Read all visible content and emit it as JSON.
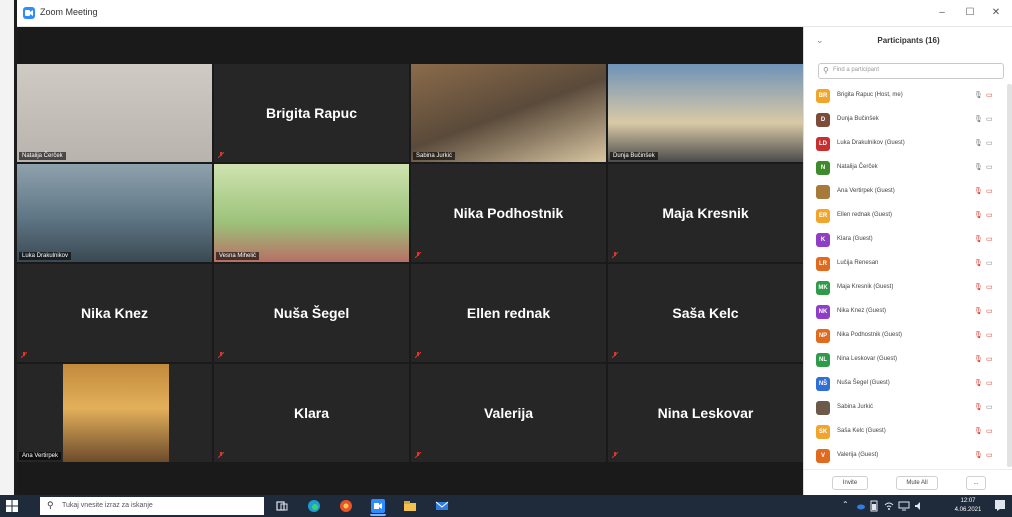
{
  "window": {
    "title": "Zoom Meeting",
    "minimize": "–",
    "maximize": "☐",
    "close": "✕"
  },
  "gallery": {
    "tiles": [
      {
        "name": "",
        "label": "Natalija Čerček",
        "video": true
      },
      {
        "name": "Brigita Rapuc",
        "label": "",
        "video": false
      },
      {
        "name": "",
        "label": "Sabina Jurkić",
        "video": true
      },
      {
        "name": "",
        "label": "Dunja Bučinšek",
        "video": true
      },
      {
        "name": "",
        "label": "Luka Drakulnikov",
        "video": true,
        "highlight": true
      },
      {
        "name": "",
        "label": "Vesna Mihelič",
        "video": true
      },
      {
        "name": "Nika Podhostnik",
        "label": "",
        "video": false
      },
      {
        "name": "Maja Kresnik",
        "label": "",
        "video": false
      },
      {
        "name": "Nika Knez",
        "label": "",
        "video": false
      },
      {
        "name": "Nuša Šegel",
        "label": "",
        "video": false
      },
      {
        "name": "Ellen rednak",
        "label": "",
        "video": false
      },
      {
        "name": "Saša Kelc",
        "label": "",
        "video": false
      },
      {
        "name": "",
        "label": "Ana Vertirpek",
        "video": true
      },
      {
        "name": "Klara",
        "label": "",
        "video": false
      },
      {
        "name": "Valerija",
        "label": "",
        "video": false
      },
      {
        "name": "Nina Leskovar",
        "label": "",
        "video": false
      }
    ]
  },
  "participants": {
    "title": "Participants (16)",
    "collapse_icon": "chevron-down-icon",
    "search_placeholder": "Find a participant",
    "items": [
      {
        "initials": "BR",
        "name": "Brigita Rapuc (Host, me)",
        "color": "#f0a52c",
        "mic": "on",
        "cam": "off"
      },
      {
        "initials": "D",
        "name": "Dunja Bučinšek",
        "color": "#7d4b3a",
        "mic": "on",
        "cam": "on"
      },
      {
        "initials": "LD",
        "name": "Luka Drakulnikov (Guest)",
        "color": "#c82f2f",
        "mic": "on",
        "cam": "on"
      },
      {
        "initials": "N",
        "name": "Natalija Čerček",
        "color": "#3f8a2a",
        "mic": "on",
        "cam": "on"
      },
      {
        "initials": "",
        "name": "Ana Vertirpek (Guest)",
        "color": "#a57a3a",
        "mic": "off",
        "cam": "off"
      },
      {
        "initials": "ER",
        "name": "Ellen rednak (Guest)",
        "color": "#f0a52c",
        "mic": "off",
        "cam": "off"
      },
      {
        "initials": "K",
        "name": "Klara (Guest)",
        "color": "#8e3ec7",
        "mic": "off",
        "cam": "off"
      },
      {
        "initials": "LR",
        "name": "Lučija Renesan",
        "color": "#e06b1f",
        "mic": "off",
        "cam": "on"
      },
      {
        "initials": "MK",
        "name": "Maja Kresnik (Guest)",
        "color": "#2f9a4a",
        "mic": "off",
        "cam": "off"
      },
      {
        "initials": "NK",
        "name": "Nika Knez (Guest)",
        "color": "#8e3ec7",
        "mic": "off",
        "cam": "off"
      },
      {
        "initials": "NP",
        "name": "Nika Podhostnik (Guest)",
        "color": "#e06b1f",
        "mic": "off",
        "cam": "off"
      },
      {
        "initials": "NL",
        "name": "Nina Leskovar (Guest)",
        "color": "#2f9a4a",
        "mic": "off",
        "cam": "off"
      },
      {
        "initials": "NŠ",
        "name": "Nuša Šegel (Guest)",
        "color": "#2f6fd6",
        "mic": "off",
        "cam": "off"
      },
      {
        "initials": "",
        "name": "Sabina Jurkić",
        "color": "#6b5a4a",
        "mic": "off",
        "cam": "on"
      },
      {
        "initials": "SK",
        "name": "Saša Kelc (Guest)",
        "color": "#f0a52c",
        "mic": "off",
        "cam": "off"
      },
      {
        "initials": "V",
        "name": "Valerija (Guest)",
        "color": "#e06b1f",
        "mic": "off",
        "cam": "off"
      }
    ],
    "invite_label": "Invite",
    "mute_all_label": "Mute All",
    "more_label": "..."
  },
  "taskbar": {
    "search_text": "Tukaj vnesite izraz za iskanje",
    "time": "12:07",
    "date": "4.06.2021"
  },
  "colors": {
    "stage": "#1a1a1a",
    "tile": "#262626",
    "highlight": "#c7d84a",
    "muted": "#e0352b",
    "taskbar": "#1f2b3a"
  }
}
